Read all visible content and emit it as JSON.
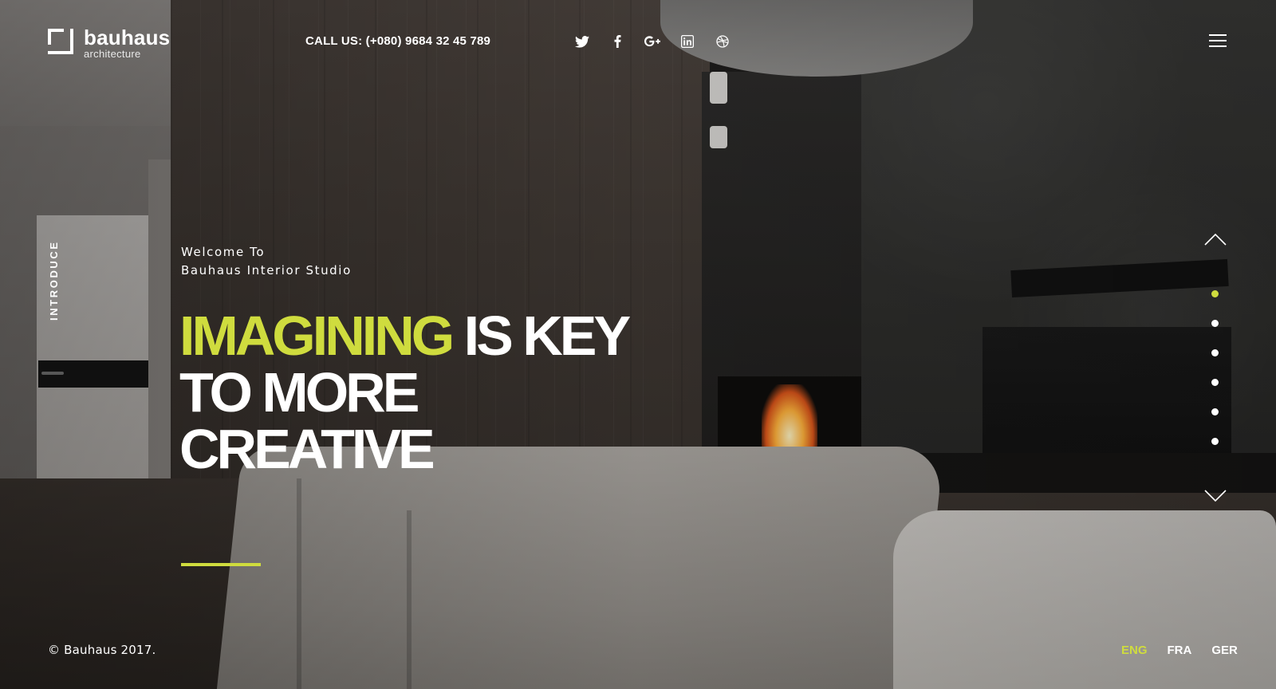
{
  "brand": {
    "name": "bauhaus",
    "tagline": "architecture"
  },
  "header": {
    "call_label": "CALL US: (+080) 9684 32 45 789",
    "social_icons": [
      "twitter-icon",
      "facebook-icon",
      "google-plus-icon",
      "linkedin-icon",
      "dribbble-icon"
    ],
    "menu_icon": "hamburger-menu-icon"
  },
  "side_label": "INTRODUCE",
  "hero": {
    "welcome_line1": "Welcome To",
    "welcome_line2": "Bauhaus Interior Studio",
    "headline_highlight": "IMAGINING",
    "headline_rest_line1": "IS KEY",
    "headline_line2": "TO MORE",
    "headline_line3": "CREATIVE"
  },
  "pager": {
    "up_icon": "chevron-up-icon",
    "down_icon": "chevron-down-icon",
    "slide_count": 6,
    "active_slide": 1
  },
  "footer": {
    "copyright": "© Bauhaus 2017.",
    "languages": [
      {
        "label": "ENG",
        "active": true
      },
      {
        "label": "FRA",
        "active": false
      },
      {
        "label": "GER",
        "active": false
      }
    ]
  },
  "colors": {
    "accent": "#cfdc3e",
    "text": "#ffffff"
  }
}
